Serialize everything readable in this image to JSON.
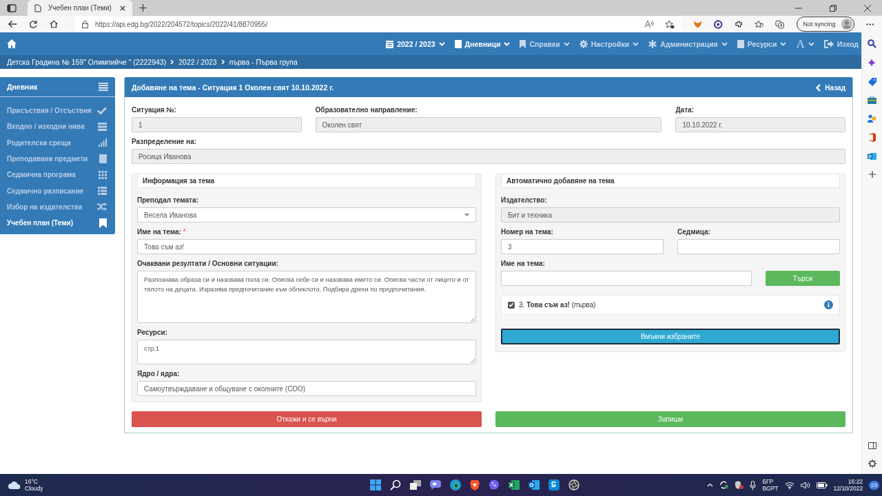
{
  "browser": {
    "tab_title": "Учебен план (Теми)",
    "url": "https://api.edg.bg/2022/204572/topics/2022/41/8870955/",
    "sync_label": "Not syncing"
  },
  "navbar": {
    "items": [
      {
        "label": "2022 / 2023",
        "active": true,
        "dropdown": true
      },
      {
        "label": "Дневници",
        "active": true,
        "dropdown": true
      },
      {
        "label": "Справки",
        "active": false,
        "dropdown": true
      },
      {
        "label": "Настройки",
        "active": false,
        "dropdown": true
      },
      {
        "label": "Администрация",
        "active": false,
        "dropdown": true
      },
      {
        "label": "Ресурси",
        "active": false,
        "dropdown": true
      },
      {
        "label": "A",
        "active": false,
        "dropdown": true
      },
      {
        "label": "Изход",
        "active": false,
        "dropdown": false
      }
    ]
  },
  "breadcrumb": [
    "Детска Градина № 159\" Олимпийче \" (2222943)",
    "2022 / 2023",
    "първа - Първа група"
  ],
  "sidebar": {
    "title": "Дневник",
    "items": [
      {
        "label": "Присъствия / Отсъствия",
        "selected": false
      },
      {
        "label": "Входно / изходни нива",
        "selected": false
      },
      {
        "label": "Родителски срещи",
        "selected": false
      },
      {
        "label": "Преподавани предмети",
        "selected": false
      },
      {
        "label": "Седмична програма",
        "selected": false
      },
      {
        "label": "Седмично разписание",
        "selected": false
      },
      {
        "label": "Избор на издателства",
        "selected": false
      },
      {
        "label": "Учебен план (Теми)",
        "selected": true
      }
    ]
  },
  "panel": {
    "title": "Добавяне на тема - Ситуация 1 Околен свят 10.10.2022 г.",
    "back": "Назад",
    "top_fields": [
      {
        "label": "Ситуация №:",
        "value": "1"
      },
      {
        "label": "Образователно направление:",
        "value": "Околен свят"
      },
      {
        "label": "Дата:",
        "value": "10.10.2022 г."
      }
    ],
    "distribution": {
      "label": "Разпределение на:",
      "value": "Росица Иванова"
    },
    "topic_info": {
      "title": "Информация за тема",
      "fields": [
        {
          "kind": "select",
          "label": "Преподал темата:",
          "value": "Весела Иванова"
        },
        {
          "kind": "input",
          "label": "Име на тема:",
          "value": "Това съм аз!",
          "required_mark": "*"
        },
        {
          "kind": "textarea",
          "label": "Очаквани резултати / Основни ситуации:",
          "value": "Разпознава образа си и назовава пола си. Описва себе си и назовава името си. Описва части от лицето и от тялото на децата. Изразява предпочитание към облеклото. Подбира дрехи по предпочитания."
        },
        {
          "kind": "textarea",
          "label": "Ресурси:",
          "value": "стр.1"
        },
        {
          "kind": "input",
          "label": "Ядро / ядра:",
          "value": "Самоутвърждаване и общуване с околните (СОО)"
        }
      ]
    },
    "auto_add": {
      "title": "Автоматично добавяне на тема",
      "publisher": {
        "label": "Издателство:",
        "value": "Бит и техника"
      },
      "number": {
        "label": "Номер на тема:",
        "value": "3"
      },
      "week": {
        "label": "Седмица:"
      },
      "name": {
        "label": "Име на тема:"
      },
      "search_button": "Търси",
      "results": [
        {
          "text": "3. **Това съм аз!** (първа)",
          "checked": true
        }
      ],
      "insert_button": "Вмъкни избраните"
    },
    "cancel_button": "Откажи и се върни",
    "save_button": "Запиши"
  },
  "taskbar": {
    "temperature": "16°C",
    "weather": "Cloudy",
    "language": "БГР",
    "keyboard": "BGPT",
    "time": "16:22",
    "date": "12/10/2022",
    "notifications": "23"
  }
}
